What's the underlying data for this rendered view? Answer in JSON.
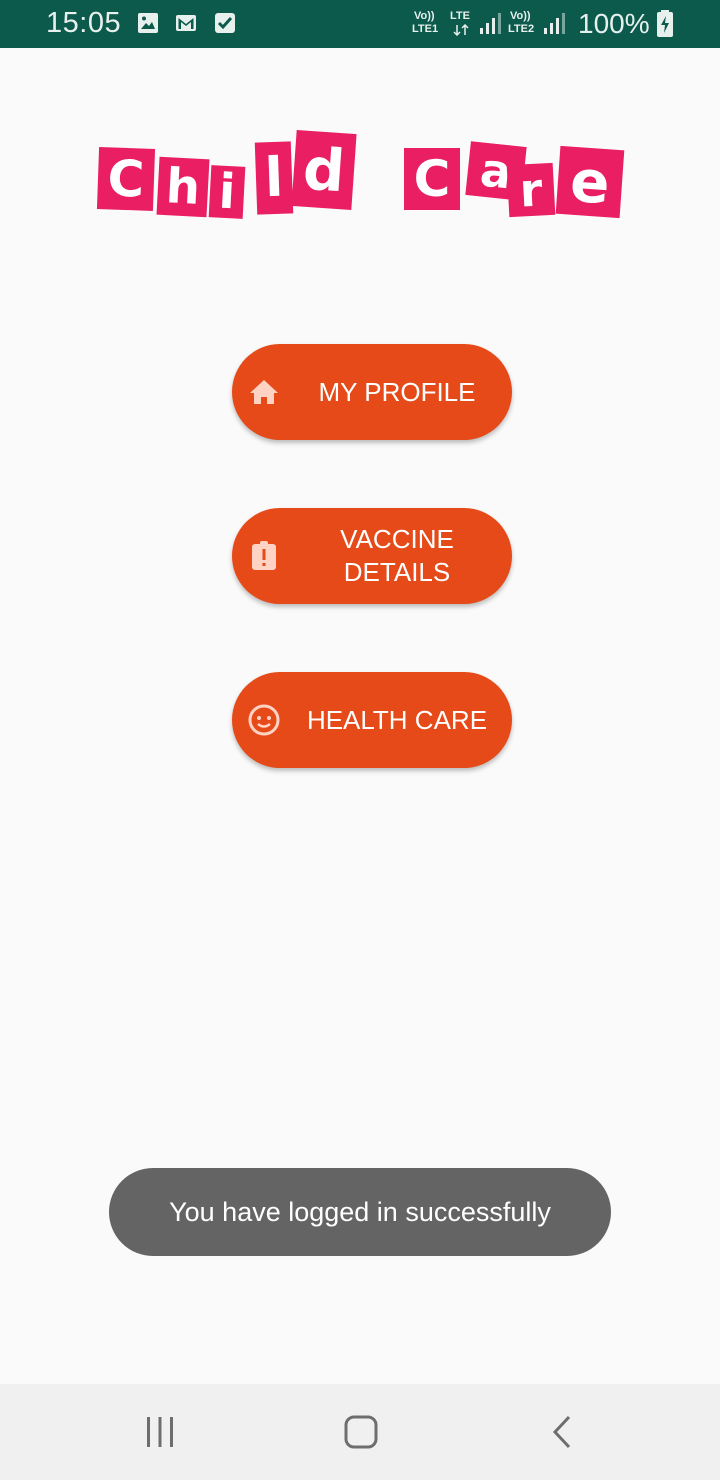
{
  "status_bar": {
    "time": "15:05",
    "battery": "100%",
    "net1_top": "Vo))",
    "net1_bottom": "LTE1",
    "net_lte": "LTE",
    "net2_top": "Vo))",
    "net2_bottom": "LTE2",
    "icons": [
      "image-icon",
      "gmail-icon",
      "checkbox-icon",
      "signal-icon",
      "battery-charging-icon"
    ]
  },
  "logo": {
    "word1": [
      "C",
      "h",
      "i",
      "l",
      "d"
    ],
    "word2": [
      "C",
      "a",
      "r",
      "e"
    ],
    "color": "#e91e63"
  },
  "buttons": {
    "profile": {
      "label": "MY PROFILE",
      "icon": "home-icon"
    },
    "vaccine": {
      "label": "VACCINE DETAILS",
      "icon": "clipboard-alert-icon"
    },
    "health": {
      "label": "HEALTH CARE",
      "icon": "baby-face-icon"
    },
    "color": "#e64a19"
  },
  "toast": {
    "text": "You have logged in successfully"
  },
  "nav": {
    "items": [
      "recents-icon",
      "home-icon",
      "back-icon"
    ]
  }
}
